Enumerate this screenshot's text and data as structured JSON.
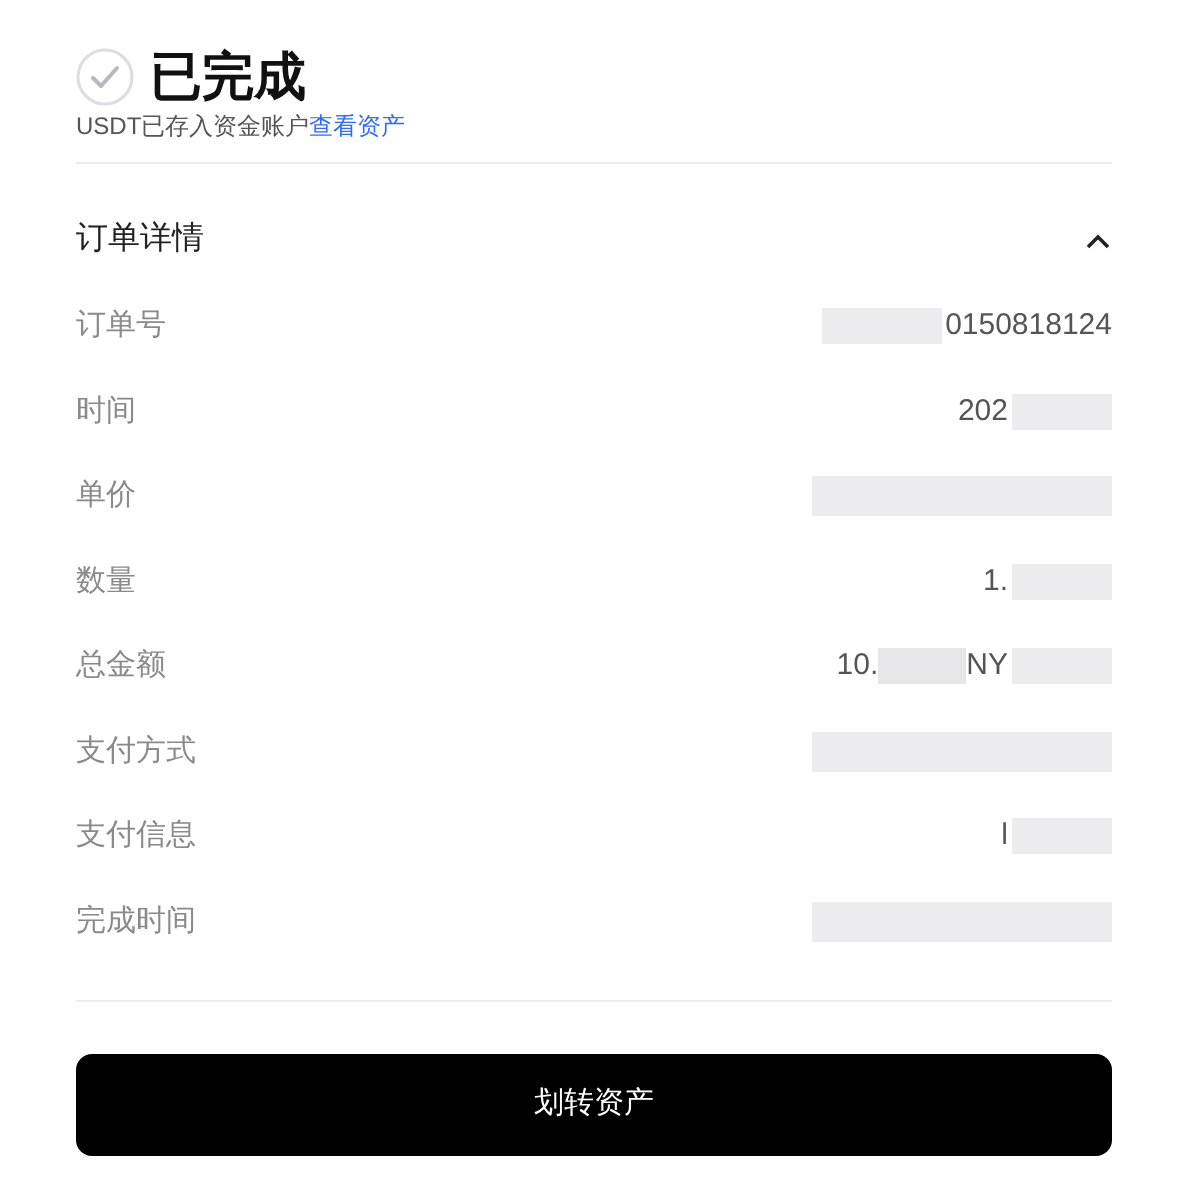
{
  "status": {
    "title": "已完成",
    "message": "USDT已存入资金账户",
    "link": "查看资产"
  },
  "details": {
    "title": "订单详情",
    "expanded": true,
    "rows": [
      {
        "label": "订单号",
        "value_fragments": [
          "0150818124"
        ]
      },
      {
        "label": "时间",
        "value_fragments": [
          "202"
        ]
      },
      {
        "label": "单价",
        "value_fragments": []
      },
      {
        "label": "数量",
        "value_fragments": [
          "1."
        ]
      },
      {
        "label": "总金额",
        "value_fragments": [
          "10.",
          "NY"
        ]
      },
      {
        "label": "支付方式",
        "value_fragments": []
      },
      {
        "label": "支付信息",
        "value_fragments": [
          "l"
        ]
      },
      {
        "label": "完成时间",
        "value_fragments": []
      }
    ]
  },
  "button": "划转资产"
}
